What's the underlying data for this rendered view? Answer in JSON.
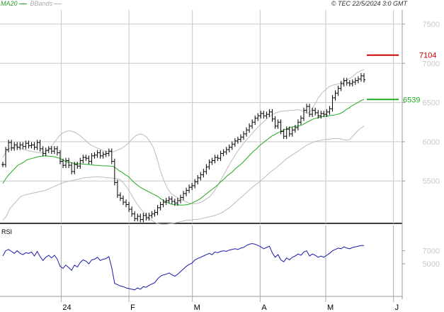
{
  "header": {
    "legend_ma": "MA20",
    "legend_bb": "BBands",
    "copyright": "© TEC 22/5/2024 3:0 GMT"
  },
  "colors": {
    "price": "#000000",
    "ma": "#22aa22",
    "bands": "#bbbbbb",
    "rsi": "#1a1aaa",
    "resistance": "#cc0000",
    "support": "#22aa22",
    "grid": "#c8c8c8"
  },
  "chart_data": [
    {
      "type": "ohlc",
      "ylim": [
        4960,
        7680
      ],
      "yticks": [
        5500,
        6000,
        6500,
        7000,
        7500
      ],
      "ytick_labels": [
        "5500",
        "6000",
        "6500",
        "7000",
        "7500"
      ],
      "xlabels": [
        {
          "label": "24",
          "date": "2024-01-01"
        },
        {
          "label": "F",
          "date": "2024-02-01"
        },
        {
          "label": "M",
          "date": "2024-03-01"
        },
        {
          "label": "A",
          "date": "2024-04-01"
        },
        {
          "label": "M",
          "date": "2024-05-01"
        },
        {
          "label": "J",
          "date": "2024-06-01"
        }
      ],
      "x_range": [
        "2023-12-04",
        "2024-06-05"
      ],
      "closes": [
        5710,
        5900,
        5990,
        5920,
        5960,
        5930,
        5960,
        5940,
        5980,
        5950,
        5960,
        5930,
        5990,
        5910,
        5850,
        5890,
        5910,
        5880,
        5910,
        5860,
        5750,
        5700,
        5760,
        5700,
        5620,
        5710,
        5690,
        5760,
        5800,
        5790,
        5750,
        5820,
        5830,
        5860,
        5820,
        5840,
        5850,
        5880,
        5750,
        5480,
        5320,
        5280,
        5230,
        5200,
        5140,
        5080,
        5020,
        5050,
        5010,
        5060,
        5030,
        5060,
        5080,
        5100,
        5160,
        5200,
        5230,
        5250,
        5270,
        5240,
        5220,
        5250,
        5290,
        5340,
        5380,
        5420,
        5440,
        5490,
        5540,
        5580,
        5620,
        5680,
        5740,
        5760,
        5800,
        5790,
        5850,
        5870,
        5900,
        5930,
        5970,
        6010,
        6030,
        6060,
        6100,
        6150,
        6200,
        6250,
        6300,
        6330,
        6360,
        6330,
        6350,
        6380,
        6290,
        6200,
        6250,
        6130,
        6070,
        6160,
        6100,
        6150,
        6180,
        6250,
        6300,
        6400,
        6450,
        6350,
        6400,
        6370,
        6330,
        6360,
        6350,
        6380,
        6420,
        6560,
        6620,
        6680,
        6740,
        6780,
        6750,
        6740,
        6760,
        6780,
        6800,
        6840,
        6790
      ],
      "ma20": [
        5470,
        5530,
        5580,
        5620,
        5660,
        5700,
        5720,
        5740,
        5770,
        5780,
        5790,
        5800,
        5810,
        5815,
        5820,
        5818,
        5815,
        5810,
        5800,
        5790,
        5770,
        5750,
        5740,
        5735,
        5720,
        5718,
        5720,
        5715,
        5712,
        5710,
        5705,
        5700,
        5698,
        5695,
        5693,
        5692,
        5690,
        5685,
        5660,
        5630,
        5610,
        5580,
        5560,
        5520,
        5480,
        5450,
        5420,
        5400,
        5380,
        5360,
        5340,
        5320,
        5300,
        5270,
        5250,
        5230,
        5210,
        5200,
        5198,
        5195,
        5192,
        5195,
        5200,
        5210,
        5230,
        5250,
        5270,
        5300,
        5330,
        5360,
        5390,
        5420,
        5450,
        5490,
        5520,
        5560,
        5590,
        5620,
        5660,
        5690,
        5720,
        5760,
        5800,
        5840,
        5880,
        5910,
        5950,
        5980,
        6010,
        6040,
        6070,
        6090,
        6110,
        6130,
        6150,
        6160,
        6180,
        6190,
        6195,
        6200,
        6210,
        6230,
        6250,
        6270,
        6290,
        6300,
        6310,
        6320,
        6325,
        6330,
        6335,
        6340,
        6350,
        6360,
        6380,
        6410,
        6430,
        6460,
        6480,
        6500,
        6525,
        6539
      ],
      "bb_upper": [
        5800,
        5880,
        5920,
        5930,
        5940,
        5920,
        5900,
        5890,
        5880,
        5870,
        5860,
        5860,
        5870,
        5900,
        5950,
        6010,
        6070,
        6110,
        6130,
        6140,
        6130,
        6110,
        6080,
        6040,
        6000,
        5960,
        5940,
        5920,
        5900,
        5880,
        5870,
        5870,
        5880,
        5900,
        5920,
        5950,
        5990,
        6040,
        6080,
        6100,
        6090,
        6060,
        6000,
        5920,
        5780,
        5620,
        5500,
        5400,
        5340,
        5310,
        5280,
        5260,
        5240,
        5220,
        5210,
        5210,
        5220,
        5240,
        5270,
        5300,
        5350,
        5420,
        5500,
        5580,
        5660,
        5740,
        5810,
        5880,
        5940,
        6000,
        6050,
        6100,
        6150,
        6200,
        6240,
        6280,
        6320,
        6350,
        6370,
        6385,
        6390,
        6395,
        6400,
        6400,
        6410,
        6400,
        6380,
        6360,
        6400,
        6480,
        6560,
        6620,
        6660,
        6700,
        6720,
        6730,
        6740,
        6760,
        6780,
        6810,
        6840,
        6880,
        6905,
        6920
      ],
      "bb_lower": [
        5000,
        5050,
        5150,
        5200,
        5250,
        5300,
        5320,
        5330,
        5340,
        5350,
        5360,
        5370,
        5380,
        5400,
        5420,
        5440,
        5460,
        5480,
        5490,
        5500,
        5510,
        5520,
        5530,
        5540,
        5545,
        5550,
        5552,
        5555,
        5550,
        5545,
        5540,
        5535,
        5530,
        5520,
        5480,
        5420,
        5350,
        5270,
        5200,
        5140,
        5090,
        5040,
        5000,
        4970,
        4955,
        4950,
        4950,
        4955,
        4960,
        4970,
        4980,
        4990,
        5000,
        5000,
        5010,
        5010,
        5020,
        5030,
        5040,
        5050,
        5060,
        5080,
        5100,
        5130,
        5160,
        5200,
        5240,
        5280,
        5320,
        5360,
        5400,
        5440,
        5470,
        5510,
        5550,
        5590,
        5630,
        5660,
        5700,
        5740,
        5780,
        5810,
        5840,
        5870,
        5900,
        5930,
        5960,
        5980,
        6000,
        6010,
        6020,
        6030,
        6030,
        6040,
        6040,
        6040,
        6030,
        6020,
        6030,
        6080,
        6130,
        6170,
        6200
      ]
    },
    {
      "type": "line",
      "title": "RSI",
      "ylim": [
        0,
        100
      ],
      "yticks": [
        50,
        70
      ],
      "ytick_labels": [
        "5000",
        "7000"
      ],
      "series": [
        {
          "values": [
            62,
            70,
            72,
            69,
            66,
            70,
            66,
            64,
            67,
            66,
            68,
            62,
            69,
            61,
            55,
            60,
            63,
            59,
            63,
            57,
            46,
            43,
            48,
            44,
            40,
            48,
            45,
            52,
            56,
            54,
            50,
            56,
            57,
            60,
            55,
            57,
            58,
            61,
            44,
            20,
            18,
            16,
            15,
            13,
            12,
            11,
            10,
            13,
            11,
            15,
            14,
            17,
            19,
            21,
            27,
            31,
            33,
            34,
            36,
            33,
            31,
            34,
            38,
            42,
            46,
            49,
            51,
            56,
            58,
            60,
            62,
            64,
            66,
            64,
            68,
            67,
            69,
            70,
            69,
            71,
            72,
            73,
            72,
            74,
            75,
            78,
            80,
            81,
            80,
            78,
            76,
            73,
            75,
            77,
            67,
            60,
            64,
            56,
            53,
            59,
            56,
            60,
            62,
            65,
            63,
            68,
            70,
            62,
            65,
            63,
            60,
            62,
            60,
            63,
            66,
            70,
            72,
            74,
            73,
            76,
            74,
            73,
            75,
            76,
            77,
            78,
            78
          ]
        }
      ]
    }
  ],
  "annotations": {
    "resistance": {
      "value": 7104,
      "label": "7104"
    },
    "support": {
      "value": 6539,
      "label": "6539"
    }
  }
}
